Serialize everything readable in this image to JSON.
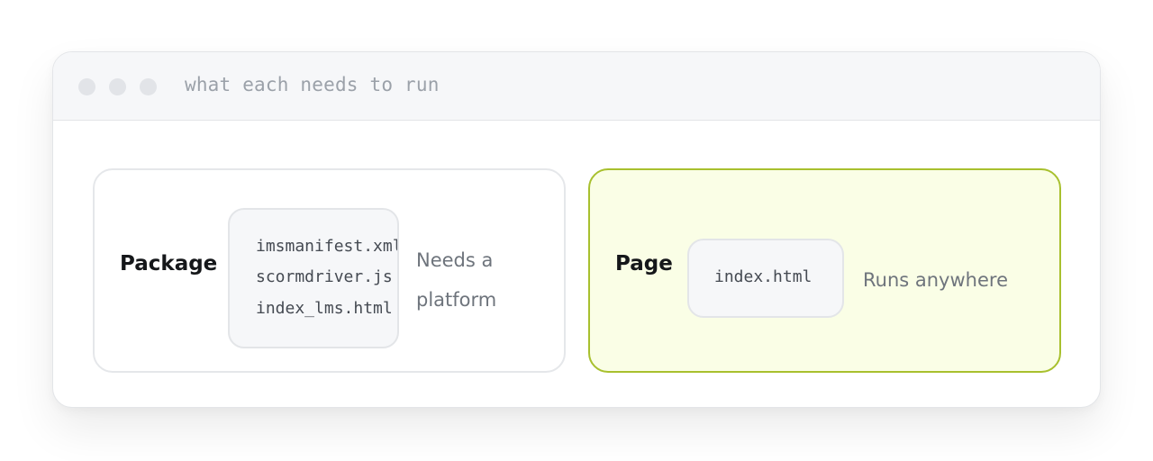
{
  "window": {
    "title": "what each needs to run"
  },
  "package": {
    "label": "Package",
    "files": [
      "imsmanifest.xml",
      "scormdriver.js",
      "index_lms.html"
    ],
    "description_line1": "Needs a",
    "description_line2": "platform"
  },
  "page": {
    "label": "Page",
    "files": [
      "index.html"
    ],
    "description": "Runs anywhere"
  },
  "colors": {
    "page_border": "#a8c02e",
    "page_fill": "#fafee6",
    "package_border": "#e5e7ea"
  }
}
